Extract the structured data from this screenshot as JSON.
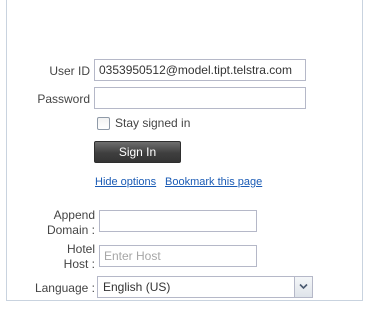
{
  "login": {
    "user_id_label": "User ID",
    "user_id_value": "0353950512@model.tipt.telstra.com",
    "password_label": "Password",
    "password_value": "",
    "stay_signed_in_label": "Stay signed in",
    "stay_signed_in_checked": false,
    "sign_in_button": "Sign In"
  },
  "links": {
    "hide_options": "Hide options",
    "bookmark": "Bookmark this page"
  },
  "options": {
    "append_domain_label_line1": "Append",
    "append_domain_label_line2": "Domain :",
    "append_domain_value": "",
    "hotel_host_label_line1": "Hotel",
    "hotel_host_label_line2": "Host :",
    "hotel_host_placeholder": "Enter Host",
    "language_label": "Language :",
    "language_value": "English (US)"
  },
  "colors": {
    "link": "#1a5bb5",
    "button_bg": "#3f3f3f",
    "border": "#b5b8c8"
  }
}
